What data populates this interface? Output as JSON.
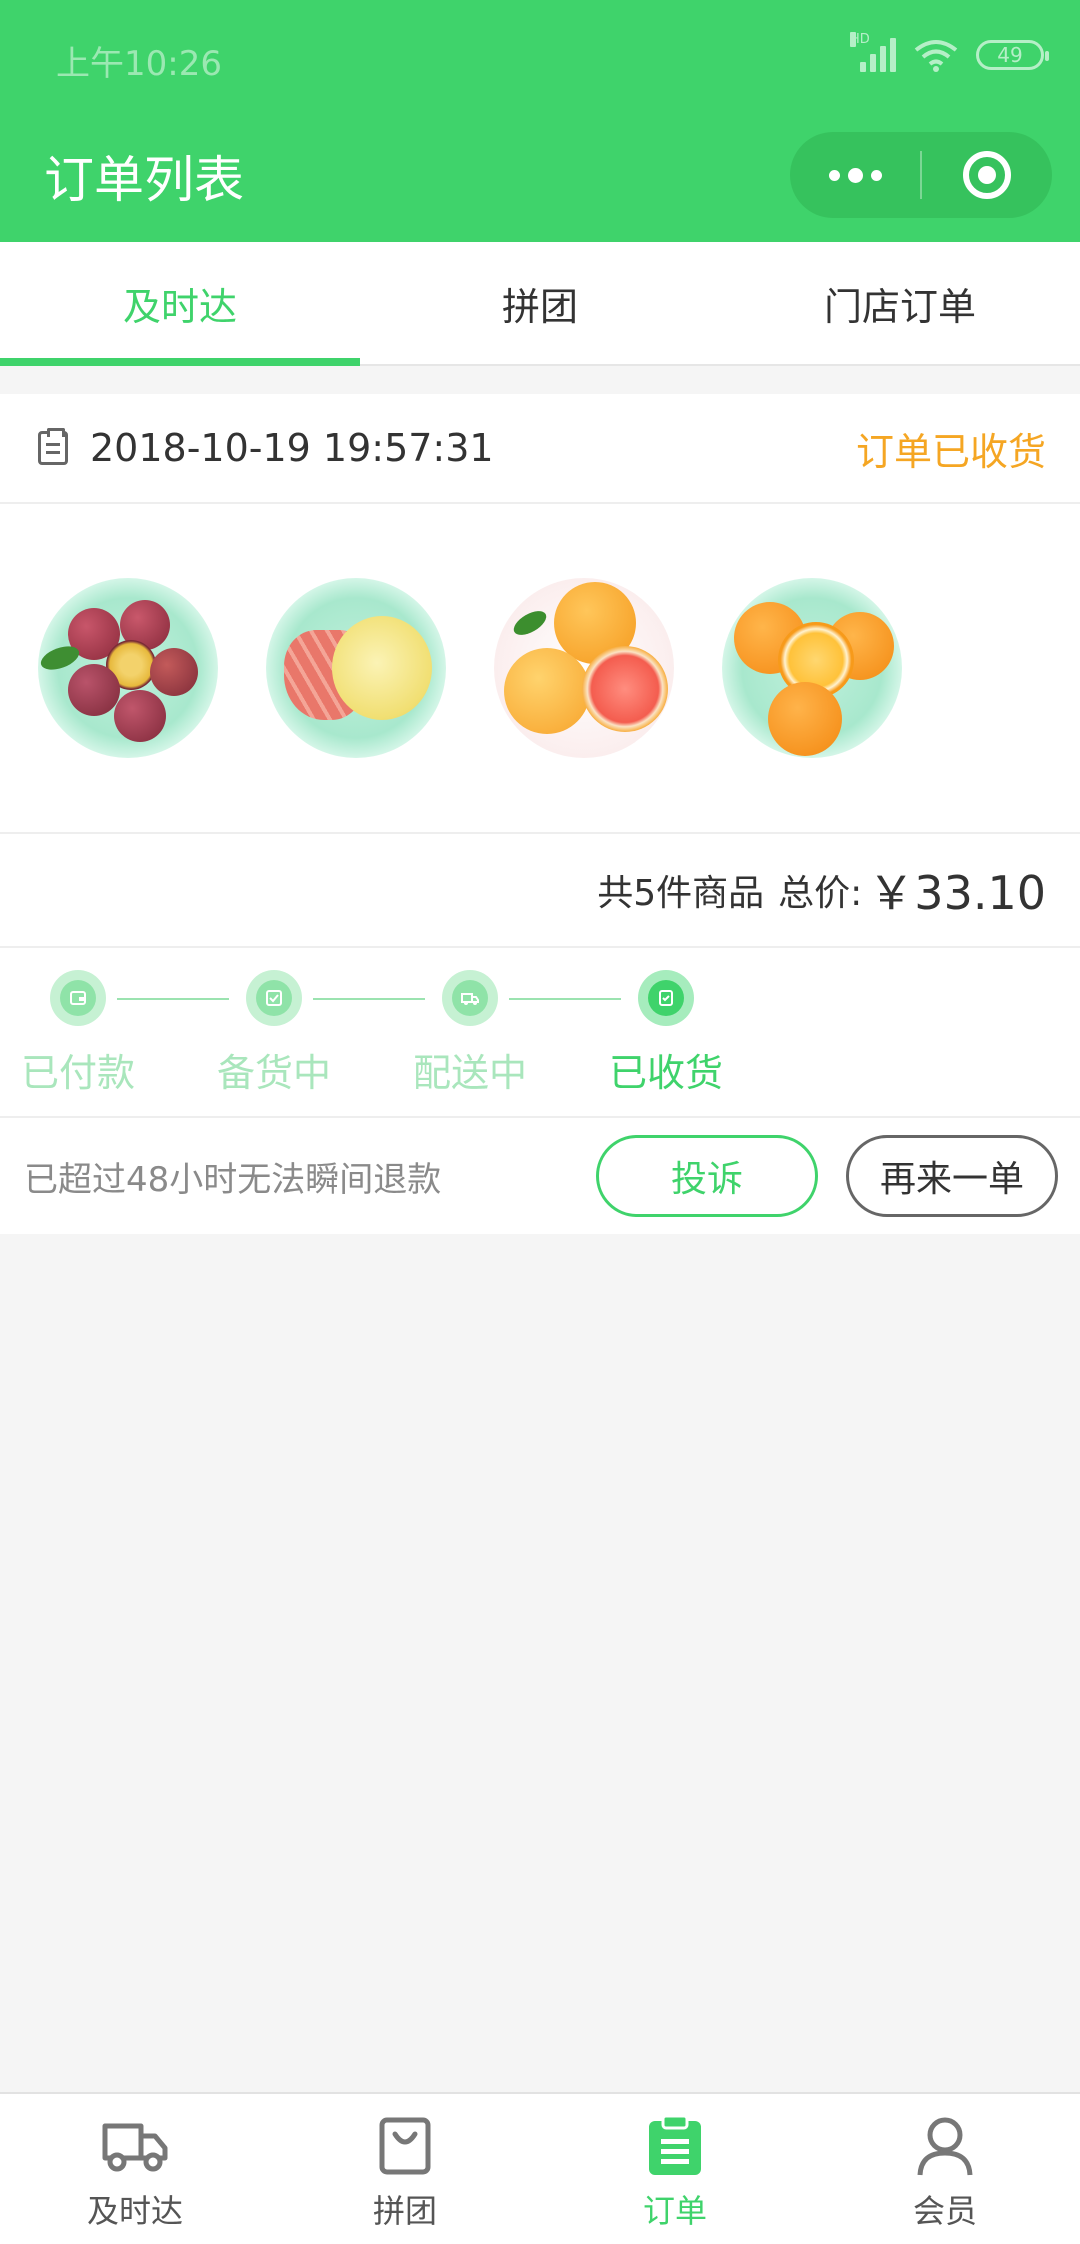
{
  "status_bar": {
    "time": "上午10:26",
    "network": "HD",
    "battery": "49"
  },
  "header": {
    "title": "订单列表"
  },
  "tabs": [
    {
      "label": "及时达",
      "active": true
    },
    {
      "label": "拼团",
      "active": false
    },
    {
      "label": "门店订单",
      "active": false
    }
  ],
  "order": {
    "datetime": "2018-10-19 19:57:31",
    "status": "订单已收货",
    "products": [
      {
        "icon": "passion-fruit-plate"
      },
      {
        "icon": "pomelo-plate"
      },
      {
        "icon": "grapefruit-plate"
      },
      {
        "icon": "orange-plate"
      }
    ],
    "item_count": "共5件商品",
    "total_label": "总价:",
    "total_price": "￥33.10",
    "progress": [
      {
        "label": "已付款",
        "icon": "wallet-icon",
        "done": false
      },
      {
        "label": "备货中",
        "icon": "check-box-icon",
        "done": false
      },
      {
        "label": "配送中",
        "icon": "truck-icon",
        "done": false
      },
      {
        "label": "已收货",
        "icon": "received-icon",
        "done": true
      }
    ],
    "refund_notice": "已超过48小时无法瞬间退款",
    "complain_label": "投诉",
    "reorder_label": "再来一单"
  },
  "bottom_nav": [
    {
      "label": "及时达",
      "icon": "truck-icon",
      "active": false
    },
    {
      "label": "拼团",
      "icon": "bag-icon",
      "active": false
    },
    {
      "label": "订单",
      "icon": "clipboard-icon",
      "active": true
    },
    {
      "label": "会员",
      "icon": "user-icon",
      "active": false
    }
  ],
  "colors": {
    "brand_green": "#3fd36b",
    "status_orange": "#f5a623"
  }
}
